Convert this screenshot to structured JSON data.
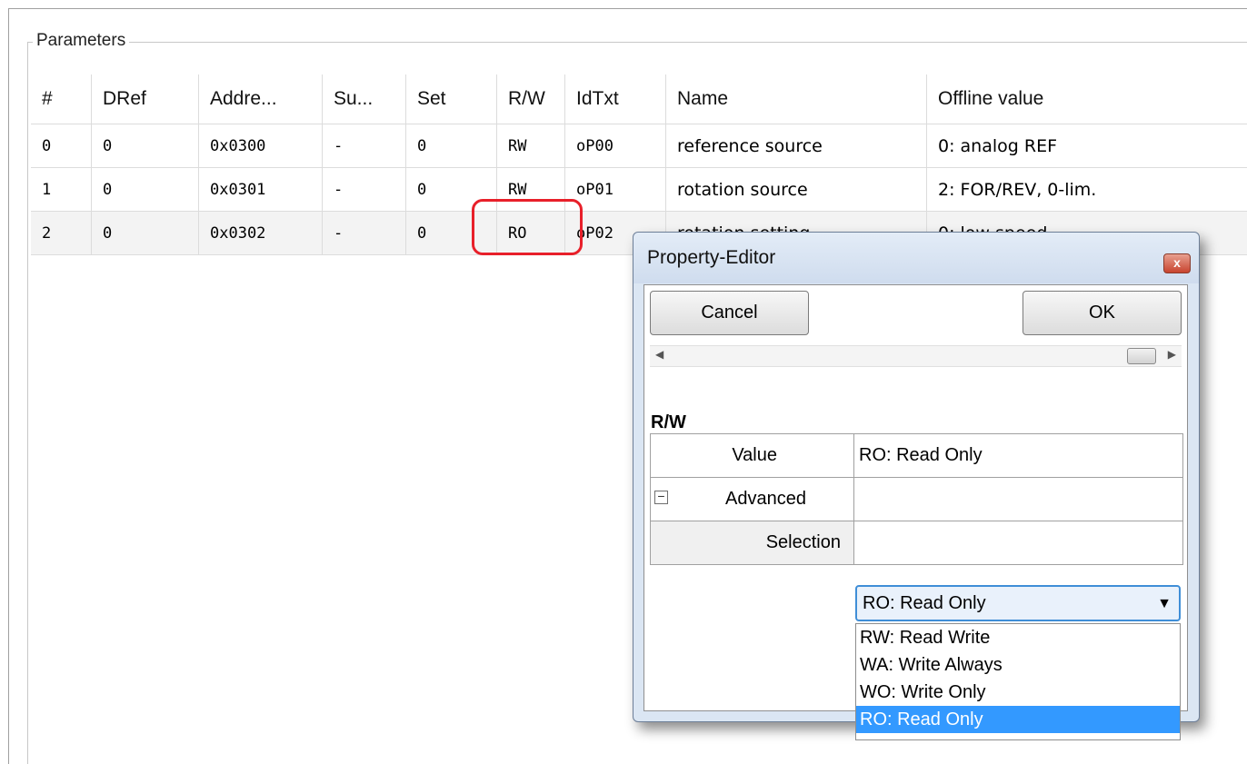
{
  "group_title": "Parameters",
  "table": {
    "columns": [
      "#",
      "DRef",
      "Addre...",
      "Su...",
      "Set",
      "R/W",
      "IdTxt",
      "Name",
      "Offline value"
    ],
    "rows": [
      [
        "0",
        "0",
        "0x0300",
        "-",
        "0",
        "RW",
        "oP00",
        "reference source",
        "0: analog REF"
      ],
      [
        "1",
        "0",
        "0x0301",
        "-",
        "0",
        "RW",
        "oP01",
        "rotation source",
        "2: FOR/REV, 0-lim."
      ],
      [
        "2",
        "0",
        "0x0302",
        "-",
        "0",
        "RO",
        "oP02",
        "rotation setting",
        "0: low speed"
      ]
    ]
  },
  "dialog": {
    "title": "Property-Editor",
    "close_label": "x",
    "cancel_label": "Cancel",
    "ok_label": "OK",
    "section": "R/W",
    "properties": {
      "value_key": "Value",
      "value_val": "RO: Read Only",
      "advanced_key": "Advanced",
      "expander_glyph": "−",
      "selection_key": "Selection"
    },
    "select": {
      "value": "RO: Read Only",
      "options": [
        "RW: Read Write",
        "WA: Write Always",
        "WO: Write Only",
        "RO: Read Only"
      ]
    }
  },
  "colors": {
    "highlight": "#e8202a",
    "selection": "#3399ff",
    "dialog_bg": "#dbe6f3"
  }
}
